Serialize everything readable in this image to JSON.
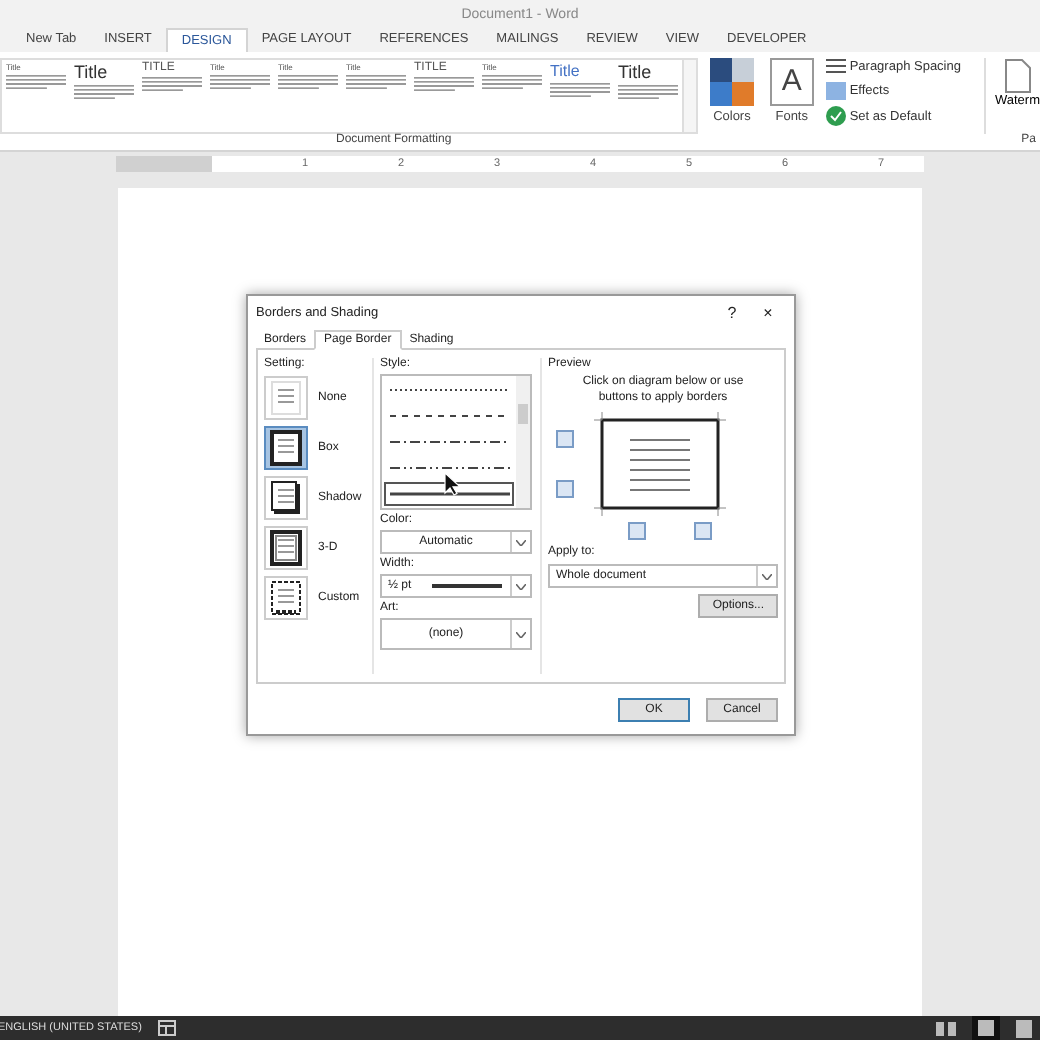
{
  "window": {
    "title": "Document1 - Word"
  },
  "ribbon_tabs": [
    {
      "label": "New Tab",
      "selected": false
    },
    {
      "label": "INSERT",
      "selected": false
    },
    {
      "label": "DESIGN",
      "selected": true
    },
    {
      "label": "PAGE LAYOUT",
      "selected": false
    },
    {
      "label": "REFERENCES",
      "selected": false
    },
    {
      "label": "MAILINGS",
      "selected": false
    },
    {
      "label": "REVIEW",
      "selected": false
    },
    {
      "label": "VIEW",
      "selected": false
    },
    {
      "label": "DEVELOPER",
      "selected": false
    }
  ],
  "style_gallery": [
    {
      "title": "Title",
      "kind": "tiny"
    },
    {
      "title": "Title",
      "kind": "large"
    },
    {
      "title": "TITLE",
      "kind": "caps"
    },
    {
      "title": "Title",
      "kind": "tiny"
    },
    {
      "title": "Title",
      "kind": "tiny"
    },
    {
      "title": "Title",
      "kind": "tiny"
    },
    {
      "title": "TITLE",
      "kind": "caps"
    },
    {
      "title": "Title",
      "kind": "tiny"
    },
    {
      "title": "Title",
      "kind": "accent"
    },
    {
      "title": "Title",
      "kind": "large"
    }
  ],
  "theme_buttons": [
    {
      "label": "Colors",
      "kind": "colors"
    },
    {
      "label": "Fonts",
      "kind": "fonts",
      "icon_text": "A"
    }
  ],
  "design_options": [
    {
      "label": "Paragraph Spacing",
      "kind": "spacing"
    },
    {
      "label": "Effects",
      "kind": "effects"
    },
    {
      "label": "Set as Default",
      "kind": "default"
    }
  ],
  "watermark_button": "Waterm",
  "group_labels": [
    "Document Formatting",
    "Pa"
  ],
  "ruler_numbers": [
    "1",
    "2",
    "3",
    "4",
    "5",
    "6",
    "7"
  ],
  "dialog": {
    "title": "Borders and Shading",
    "help": "?",
    "close": "×",
    "tabs": [
      {
        "label": "Borders",
        "selected": false
      },
      {
        "label": "Page Border",
        "selected": true
      },
      {
        "label": "Shading",
        "selected": false
      }
    ],
    "setting_label": "Setting:",
    "settings": [
      {
        "label": "None",
        "kind": "none",
        "selected": false
      },
      {
        "label": "Box",
        "kind": "box",
        "selected": true
      },
      {
        "label": "Shadow",
        "kind": "shadow",
        "selected": false
      },
      {
        "label": "3-D",
        "kind": "threed",
        "selected": false
      },
      {
        "label": "Custom",
        "kind": "custom",
        "selected": false
      }
    ],
    "style_label": "Style:",
    "styles": [
      {
        "kind": "dotted",
        "selected": false
      },
      {
        "kind": "dashed",
        "selected": false
      },
      {
        "kind": "dashdot",
        "selected": false
      },
      {
        "kind": "dashdotdot",
        "selected": false
      },
      {
        "kind": "solid",
        "selected": true
      }
    ],
    "color_label": "Color:",
    "color_value": "Automatic",
    "width_label": "Width:",
    "width_value": "½ pt",
    "art_label": "Art:",
    "art_value": "(none)",
    "preview_label": "Preview",
    "preview_hint": "Click on diagram below or use buttons to apply borders",
    "apply_label": "Apply to:",
    "apply_value": "Whole document",
    "options_button": "Options...",
    "buttons": [
      "OK",
      "Cancel"
    ]
  },
  "status_bar": {
    "language": "ENGLISH (UNITED STATES)"
  }
}
